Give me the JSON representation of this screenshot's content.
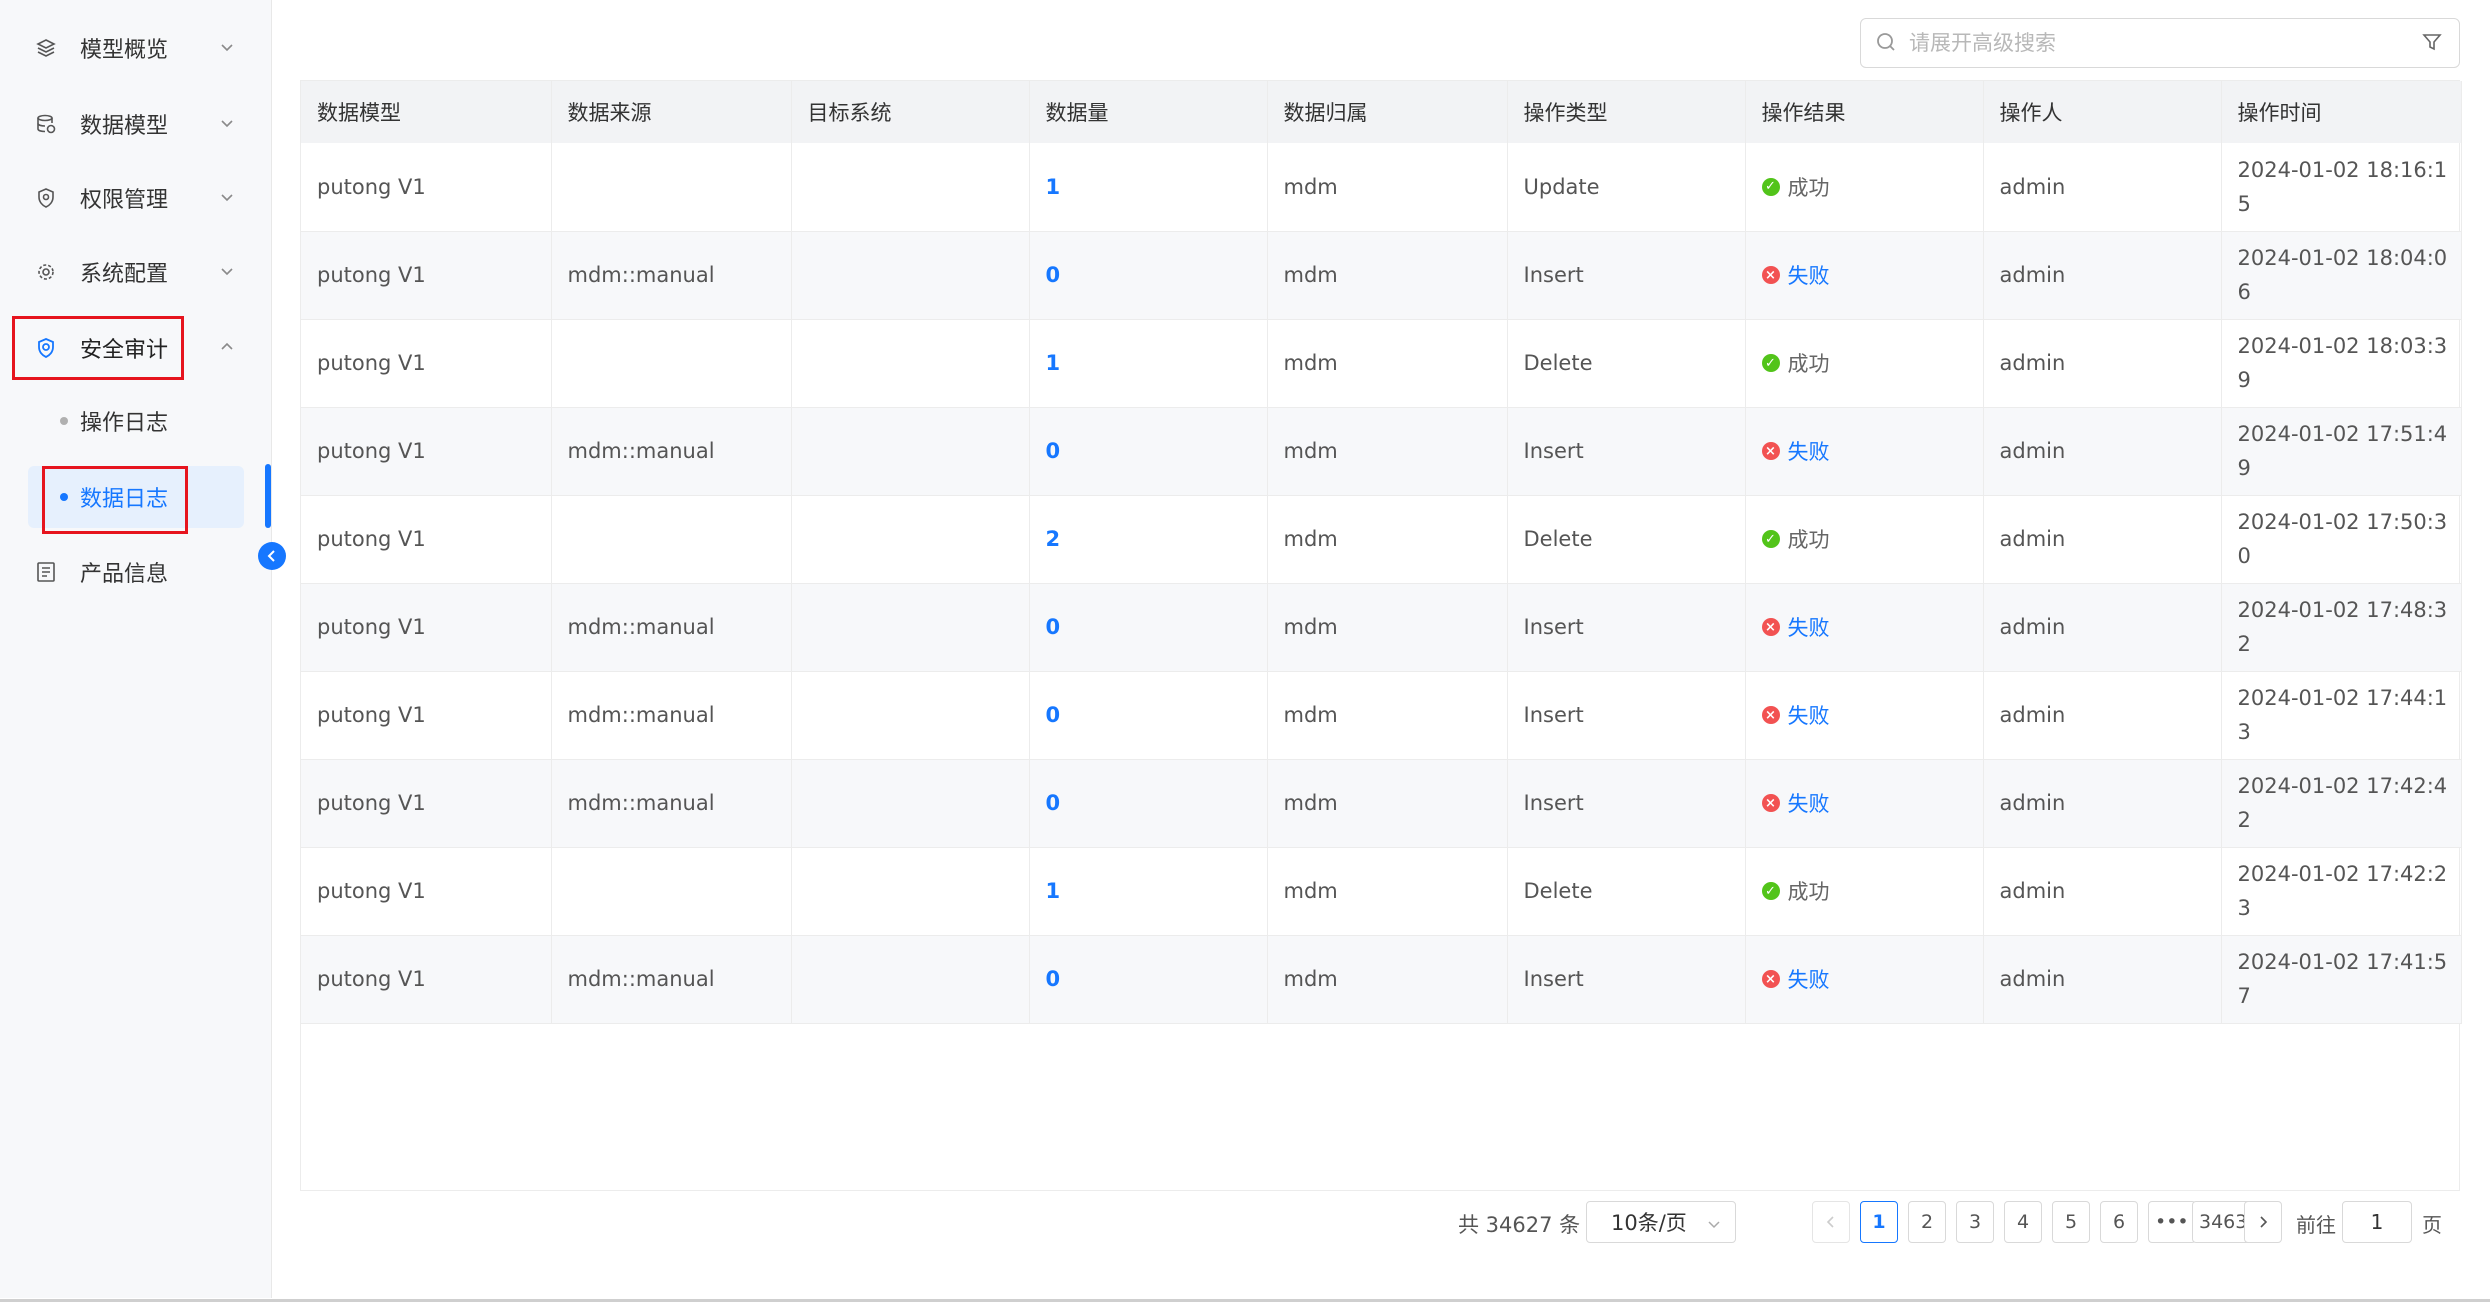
{
  "sidebar": {
    "items": [
      {
        "label": "模型概览",
        "icon": "layers-icon"
      },
      {
        "label": "数据模型",
        "icon": "database-icon"
      },
      {
        "label": "权限管理",
        "icon": "shield-icon"
      },
      {
        "label": "系统配置",
        "icon": "gear-icon"
      },
      {
        "label": "安全审计",
        "icon": "audit-shield-icon"
      },
      {
        "label": "产品信息",
        "icon": "document-icon"
      }
    ],
    "sub_items": [
      {
        "label": "操作日志"
      },
      {
        "label": "数据日志"
      }
    ],
    "selected": "数据日志"
  },
  "search": {
    "placeholder": "请展开高级搜索"
  },
  "table": {
    "headers": [
      "数据模型",
      "数据来源",
      "目标系统",
      "数据量",
      "数据归属",
      "操作类型",
      "操作结果",
      "操作人",
      "操作时间"
    ],
    "rows": [
      {
        "model": "putong V1",
        "source": "",
        "target": "",
        "count": "1",
        "owner": "mdm",
        "op": "Update",
        "result": "成功",
        "ok": true,
        "user": "admin",
        "time": "2024-01-02 18:16:15"
      },
      {
        "model": "putong V1",
        "source": "mdm::manual",
        "target": "",
        "count": "0",
        "owner": "mdm",
        "op": "Insert",
        "result": "失败",
        "ok": false,
        "user": "admin",
        "time": "2024-01-02 18:04:06"
      },
      {
        "model": "putong V1",
        "source": "",
        "target": "",
        "count": "1",
        "owner": "mdm",
        "op": "Delete",
        "result": "成功",
        "ok": true,
        "user": "admin",
        "time": "2024-01-02 18:03:39"
      },
      {
        "model": "putong V1",
        "source": "mdm::manual",
        "target": "",
        "count": "0",
        "owner": "mdm",
        "op": "Insert",
        "result": "失败",
        "ok": false,
        "user": "admin",
        "time": "2024-01-02 17:51:49"
      },
      {
        "model": "putong V1",
        "source": "",
        "target": "",
        "count": "2",
        "owner": "mdm",
        "op": "Delete",
        "result": "成功",
        "ok": true,
        "user": "admin",
        "time": "2024-01-02 17:50:30"
      },
      {
        "model": "putong V1",
        "source": "mdm::manual",
        "target": "",
        "count": "0",
        "owner": "mdm",
        "op": "Insert",
        "result": "失败",
        "ok": false,
        "user": "admin",
        "time": "2024-01-02 17:48:32"
      },
      {
        "model": "putong V1",
        "source": "mdm::manual",
        "target": "",
        "count": "0",
        "owner": "mdm",
        "op": "Insert",
        "result": "失败",
        "ok": false,
        "user": "admin",
        "time": "2024-01-02 17:44:13"
      },
      {
        "model": "putong V1",
        "source": "mdm::manual",
        "target": "",
        "count": "0",
        "owner": "mdm",
        "op": "Insert",
        "result": "失败",
        "ok": false,
        "user": "admin",
        "time": "2024-01-02 17:42:42"
      },
      {
        "model": "putong V1",
        "source": "",
        "target": "",
        "count": "1",
        "owner": "mdm",
        "op": "Delete",
        "result": "成功",
        "ok": true,
        "user": "admin",
        "time": "2024-01-02 17:42:23"
      },
      {
        "model": "putong V1",
        "source": "mdm::manual",
        "target": "",
        "count": "0",
        "owner": "mdm",
        "op": "Insert",
        "result": "失败",
        "ok": false,
        "user": "admin",
        "time": "2024-01-02 17:41:57"
      }
    ]
  },
  "pagination": {
    "total": "共 34627 条",
    "page_size": "10条/页",
    "pages": [
      "1",
      "2",
      "3",
      "4",
      "5",
      "6",
      "•••",
      "3463"
    ],
    "current": "1",
    "goto_label": "前往",
    "goto_value": "1",
    "page_label": "页"
  },
  "colors": {
    "accent": "#1677ff",
    "success": "#52c41a",
    "error": "#f25252",
    "highlight": "#e6141e"
  }
}
